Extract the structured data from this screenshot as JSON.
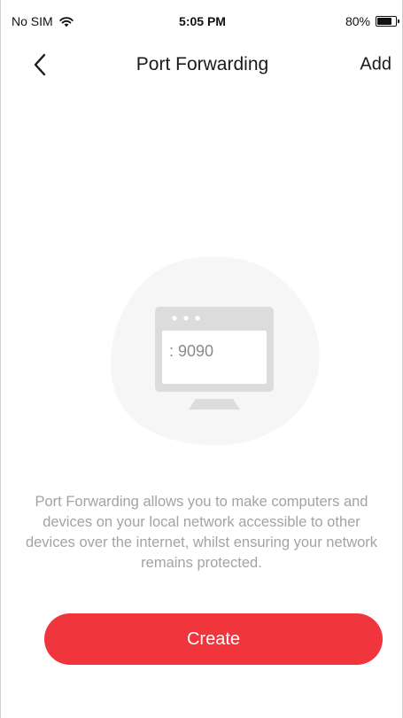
{
  "status_bar": {
    "carrier": "No SIM",
    "time": "5:05 PM",
    "battery": "80%",
    "battery_level": 0.8
  },
  "nav": {
    "back_icon": "chevron-left-icon",
    "title": "Port Forwarding",
    "add_label": "Add"
  },
  "illustration": {
    "icon": "monitor-port-icon",
    "port_text": ": 9090"
  },
  "description": "Port Forwarding allows you to make computers and devices on your local network accessible to other devices over the internet, whilst ensuring your network remains protected.",
  "create_button": {
    "label": "Create",
    "color": "#f0353c"
  },
  "colors": {
    "accent": "#f0353c",
    "description_text": "#a3a3a3",
    "illustration_gray": "#d9d9d9"
  }
}
